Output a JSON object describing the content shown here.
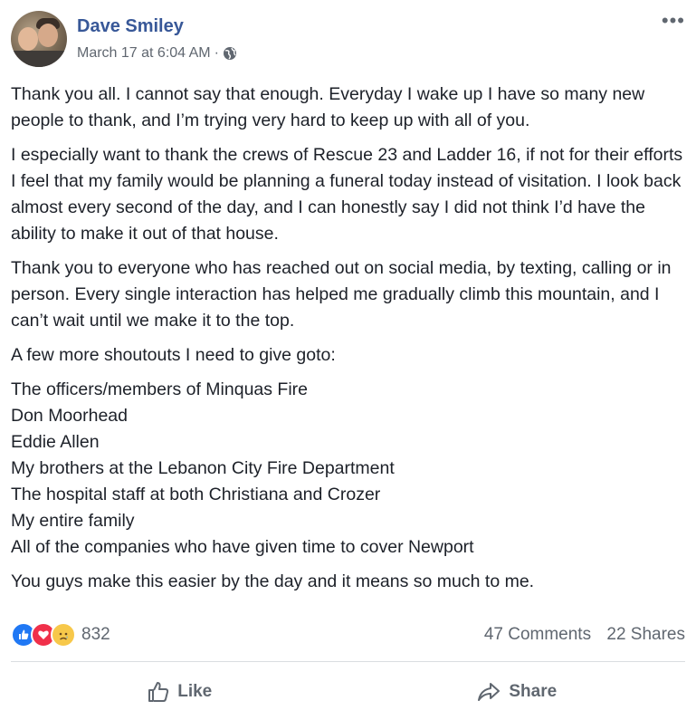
{
  "post": {
    "author": "Dave Smiley",
    "timestamp": "March 17 at 6:04 AM",
    "separator": "·",
    "privacy_icon": "globe-icon",
    "more_icon": "•••",
    "paragraphs": [
      "Thank you all. I cannot say that enough. Everyday I wake up I have so many new people to thank, and I’m trying very hard to keep up with all of you.",
      "I especially want to thank the crews of Rescue 23 and Ladder 16, if not for their efforts I feel that my family would be planning a funeral today instead of visitation. I look back almost every second of the day, and I can honestly say I did not think I’d have the ability to make it out of that house.",
      "Thank you to everyone who has reached out on social media, by texting, calling or in person. Every single interaction has helped me gradually climb this mountain, and I can’t wait until we make it to the top.",
      "A few more shoutouts I need to give goto:"
    ],
    "shoutouts": [
      "The officers/members of Minquas Fire",
      "Don Moorhead",
      "Eddie Allen",
      "My brothers at the Lebanon City Fire Department",
      "The hospital staff at both Christiana and Crozer",
      "My entire family",
      "All of the companies who have given time to cover Newport"
    ],
    "closing": "You guys make this easier by the day and it means so much to me."
  },
  "stats": {
    "reaction_count": "832",
    "comments": "47 Comments",
    "shares": "22 Shares",
    "reaction_icons": [
      "like-icon",
      "love-icon",
      "sad-icon"
    ]
  },
  "actions": {
    "like_label": "Like",
    "share_label": "Share"
  },
  "colors": {
    "author": "#385898",
    "meta": "#606770",
    "text": "#1d2129",
    "like": "#2078f4",
    "love": "#f0304a",
    "sad": "#f7c84a"
  }
}
